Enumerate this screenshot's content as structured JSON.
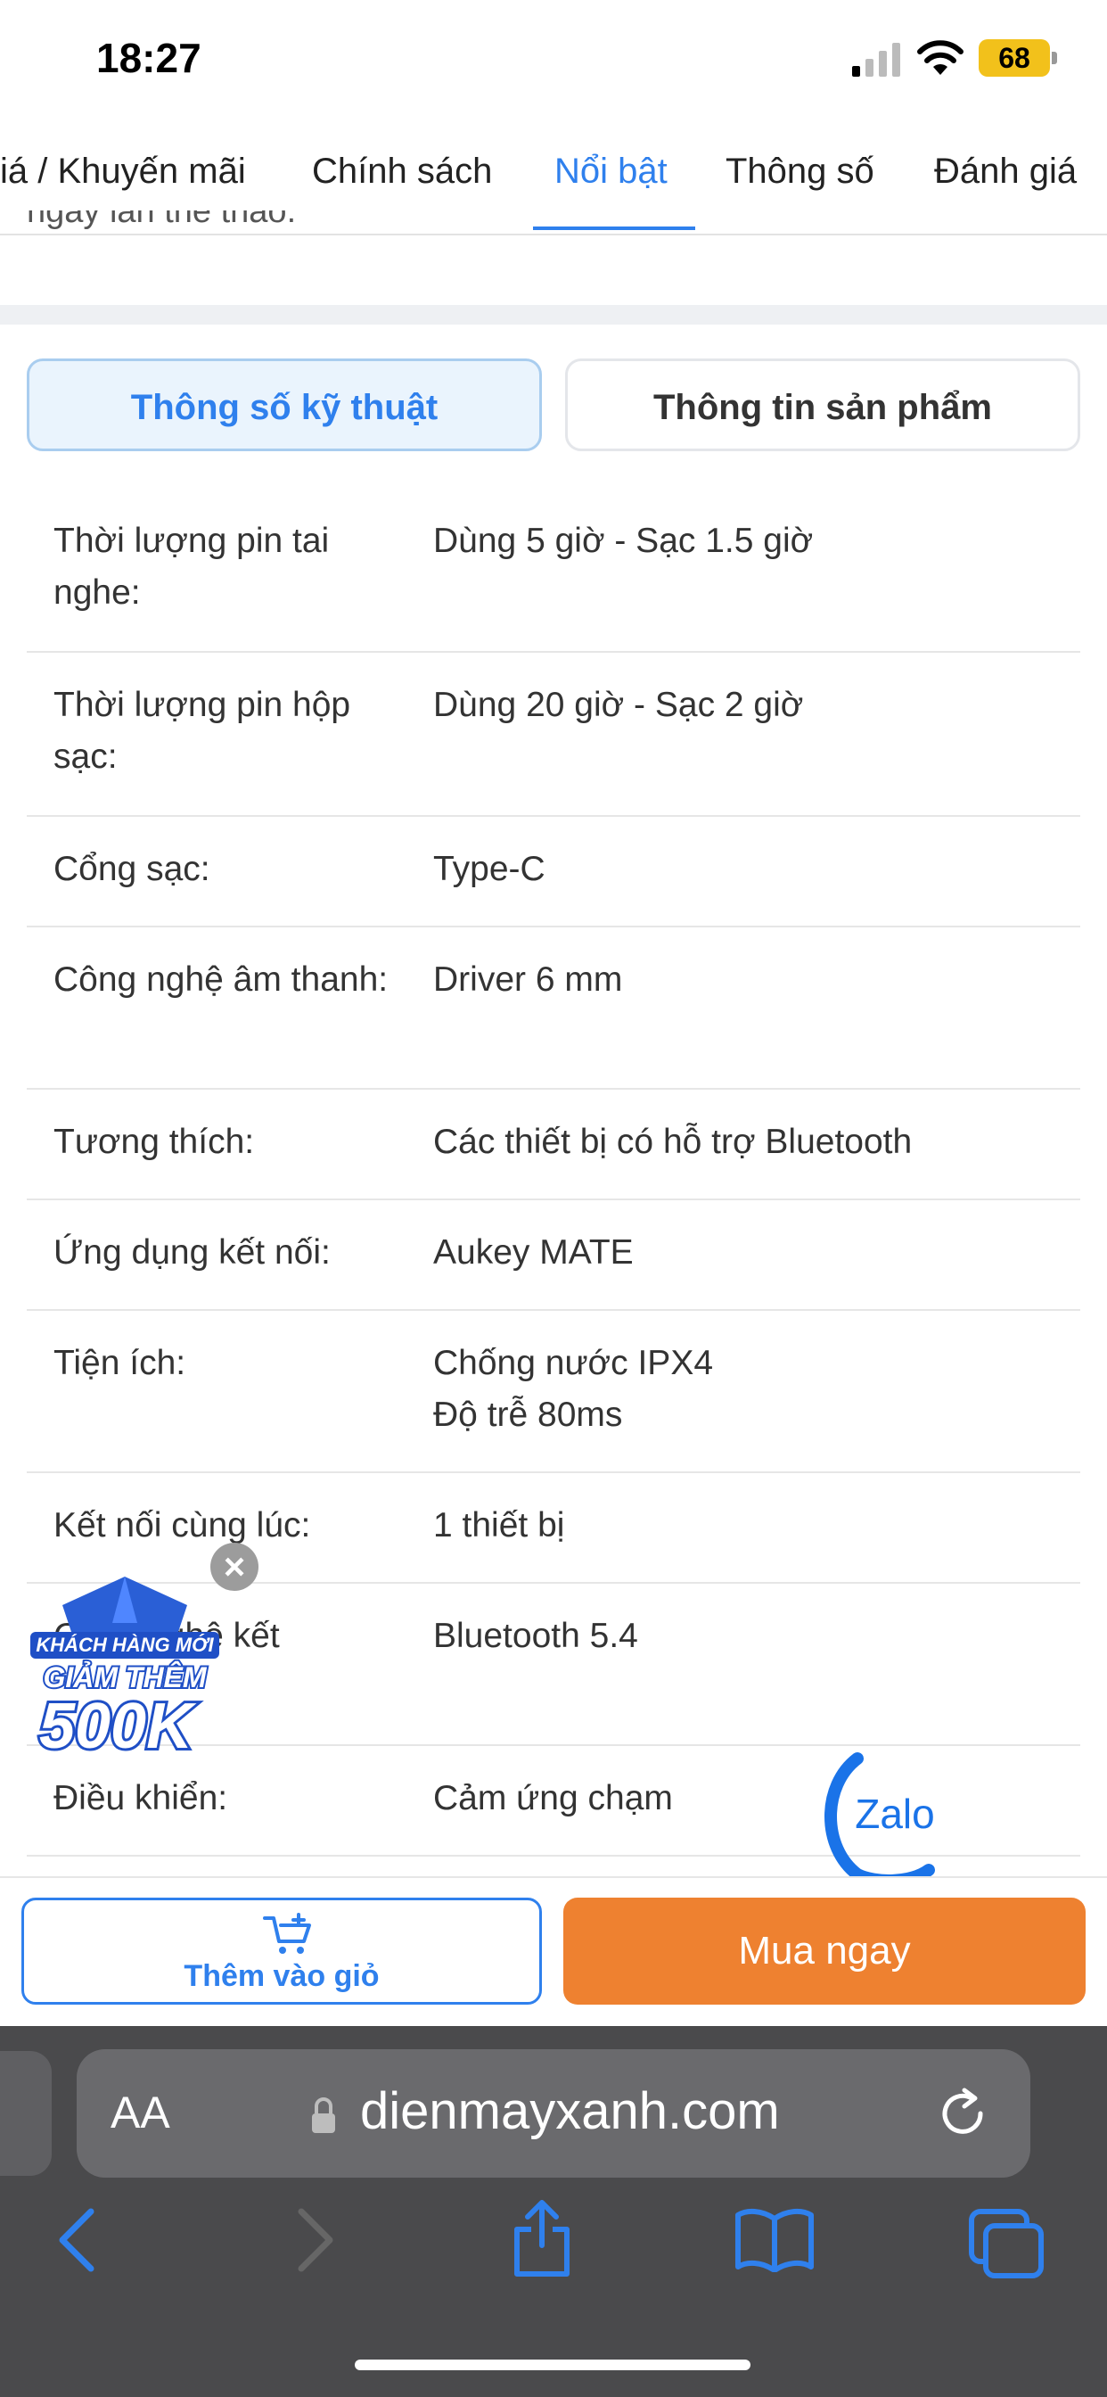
{
  "status_bar": {
    "time": "18:27",
    "battery": "68"
  },
  "tabs": [
    {
      "label": "iá / Khuyến mãi",
      "active": false
    },
    {
      "label": "Chính sách",
      "active": false
    },
    {
      "label": "Nổi bật",
      "active": true
    },
    {
      "label": "Thông số",
      "active": false
    },
    {
      "label": "Đánh giá",
      "active": false
    }
  ],
  "cut_off_text": "ngày lẫn thể thao.",
  "segment": {
    "left_label": "Thông số kỹ thuật",
    "right_label": "Thông tin sản phẩm"
  },
  "specs": [
    {
      "label": "Thời lượng pin tai nghe:",
      "value": "Dùng 5 giờ - Sạc 1.5 giờ"
    },
    {
      "label": "Thời lượng pin hộp sạc:",
      "value": "Dùng 20 giờ - Sạc 2 giờ"
    },
    {
      "label": "Cổng sạc:",
      "value": "Type-C"
    },
    {
      "label": "Công nghệ âm thanh:",
      "value": "Driver 6 mm"
    },
    {
      "label": "Tương thích:",
      "value": "Các thiết bị có hỗ trợ Bluetooth"
    },
    {
      "label": "Ứng dụng kết nối:",
      "value": "Aukey MATE"
    },
    {
      "label": "Tiện ích:",
      "value": "Chống nước IPX4\nĐộ trễ 80ms"
    },
    {
      "label": "Kết nối cùng lúc:",
      "value": "1 thiết bị"
    },
    {
      "label": "Công nghệ kết",
      "value": "Bluetooth 5.4"
    },
    {
      "label": "Điều khiển:",
      "value": "Cảm ứng chạm"
    }
  ],
  "promo": {
    "line1": "KHÁCH HÀNG MỚI",
    "line2": "GIẢM THÊM",
    "line3": "500K"
  },
  "zalo_label": "Zalo",
  "actions": {
    "cart_label": "Thêm vào giỏ",
    "buy_label": "Mua ngay"
  },
  "browser": {
    "aa_label": "AA",
    "url": "dienmayxanh.com"
  },
  "colors": {
    "accent": "#2f80ed",
    "buy": "#ee8130",
    "browser_bg": "#4a4a4c"
  }
}
